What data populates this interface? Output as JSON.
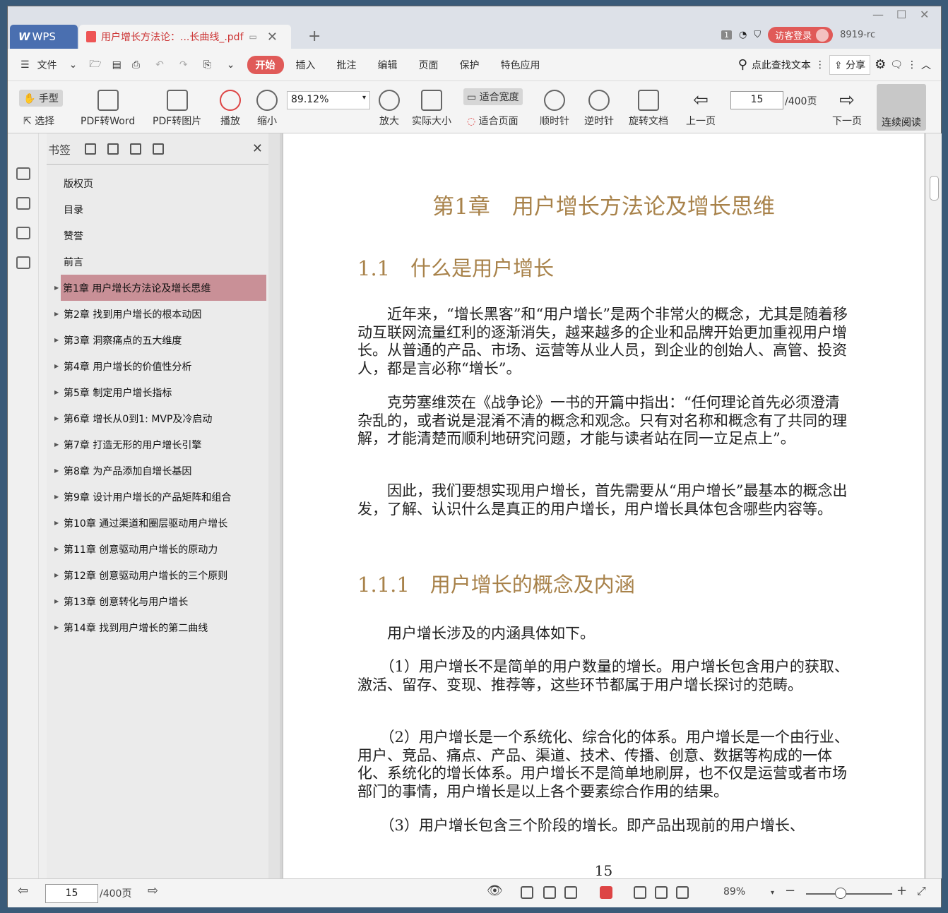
{
  "titlebar": {
    "app_tab": "WPS",
    "doc_tab": "用户增长方法论：...长曲线_.pdf",
    "page_count_badge": "1",
    "login": "访客登录",
    "user": "8919-rc"
  },
  "menubar": {
    "file": "文件",
    "items": [
      "开始",
      "插入",
      "批注",
      "编辑",
      "页面",
      "保护",
      "特色应用"
    ],
    "search": "点此查找文本",
    "share": "分享"
  },
  "toolbar": {
    "hand": "手型",
    "select": "选择",
    "pdf_word": "PDF转Word",
    "pdf_img": "PDF转图片",
    "play": "播放",
    "zoom_out": "缩小",
    "zoom_value": "89.12%",
    "zoom_in": "放大",
    "actual": "实际大小",
    "fit_width": "适合宽度",
    "fit_page": "适合页面",
    "cw": "顺时针",
    "ccw": "逆时针",
    "rotate": "旋转文档",
    "prev": "上一页",
    "page": "15",
    "total": "/400页",
    "next": "下一页",
    "continuous": "连续阅读"
  },
  "bookmark": {
    "title": "书签",
    "items": [
      "版权页",
      "目录",
      "赞誉",
      "前言",
      "第1章 用户增长方法论及增长思维",
      "第2章 找到用户增长的根本动因",
      "第3章 洞察痛点的五大维度",
      "第4章 用户增长的价值性分析",
      "第5章 制定用户增长指标",
      "第6章 增长从0到1: MVP及冷启动",
      "第7章 打造无形的用户增长引擎",
      "第8章 为产品添加自增长基因",
      "第9章 设计用户增长的产品矩阵和组合",
      "第10章 通过渠道和圈层驱动用户增长",
      "第11章 创意驱动用户增长的原动力",
      "第12章 创意驱动用户增长的三个原则",
      "第13章 创意转化与用户增长",
      "第14章 找到用户增长的第二曲线"
    ]
  },
  "page": {
    "chapter": "第1章　用户增长方法论及增长思维",
    "h1": "1.1　什么是用户增长",
    "p1": "　　近年来，“增长黑客”和“用户增长”是两个非常火的概念，尤其是随着移动互联网流量红利的逐渐消失，越来越多的企业和品牌开始更加重视用户增长。从普通的产品、市场、运营等从业人员，到企业的创始人、高管、投资人，都是言必称“增长”。",
    "p2": "　　克劳塞维茨在《战争论》一书的开篇中指出：“任何理论首先必须澄清杂乱的，或者说是混淆不清的概念和观念。只有对名称和概念有了共同的理解，才能清楚而顺利地研究问题，才能与读者站在同一立足点上”。",
    "p3": "　　因此，我们要想实现用户增长，首先需要从“用户增长”最基本的概念出发，了解、认识什么是真正的用户增长，用户增长具体包含哪些内容等。",
    "h2": "1.1.1　用户增长的概念及内涵",
    "p4": "　　用户增长涉及的内涵具体如下。",
    "p5": "　　（1）用户增长不是简单的用户数量的增长。用户增长包含用户的获取、激活、留存、变现、推荐等，这些环节都属于用户增长探讨的范畴。",
    "p6": "　　（2）用户增长是一个系统化、综合化的体系。用户增长是一个由行业、用户、竞品、痛点、产品、渠道、技术、传播、创意、数据等构成的一体化、系统化的增长体系。用户增长不是简单地刷屏，也不仅是运营或者市场部门的事情，用户增长是以上各个要素综合作用的结果。",
    "p7": "　　（3）用户增长包含三个阶段的增长。即产品出现前的用户增长、",
    "page_number": "15"
  },
  "status": {
    "page": "15",
    "total": "/400页",
    "zoom": "89%"
  }
}
